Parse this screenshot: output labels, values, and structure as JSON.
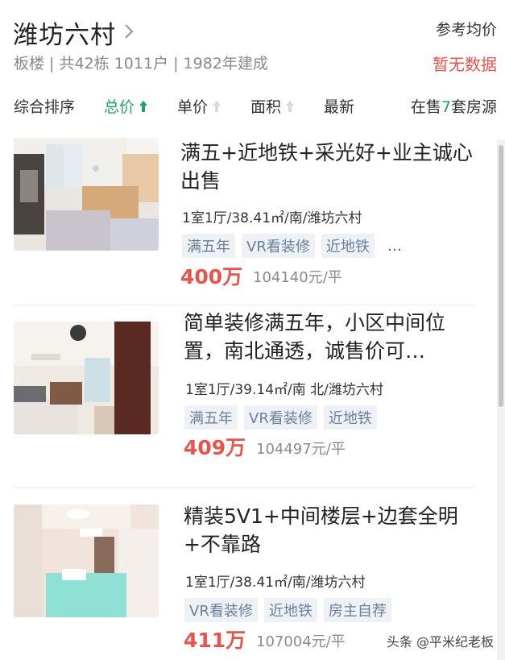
{
  "header": {
    "title": "潍坊六村",
    "subinfo": "板楼 | 共42栋 1011户 | 1982年建成",
    "ref_label": "参考均价",
    "ref_value": "暂无数据"
  },
  "sortbar": {
    "items": [
      "综合排序",
      "总价",
      "单价",
      "面积",
      "最新"
    ],
    "on_sale_prefix": "在售",
    "on_sale_count": "7",
    "on_sale_suffix": "套房源"
  },
  "listings": [
    {
      "title": "满五+近地铁+采光好+业主诚心出售",
      "meta": "1室1厅/38.41㎡/南/潍坊六村",
      "tags": [
        "满五年",
        "VR看装修",
        "近地铁"
      ],
      "more": "…",
      "price": "400万",
      "unit_price": "104140元/平"
    },
    {
      "title": "简单装修满五年，小区中间位置，南北通透，诚售价可…",
      "meta": "1室1厅/39.14㎡/南 北/潍坊六村",
      "tags": [
        "满五年",
        "VR看装修",
        "近地铁"
      ],
      "price": "409万",
      "unit_price": "104497元/平"
    },
    {
      "title": "精装5V1+中间楼层+边套全明+不靠路",
      "meta": "1室1厅/38.41㎡/南/潍坊六村",
      "tags": [
        "VR看装修",
        "近地铁",
        "房主自荐"
      ],
      "price": "411万",
      "unit_price": "107004元/平"
    }
  ],
  "watermark": "头条 @平米纪老板",
  "colors": {
    "accent_green": "#1aa36a",
    "price_red": "#e8534b",
    "tag_bg": "#eef2f7"
  }
}
